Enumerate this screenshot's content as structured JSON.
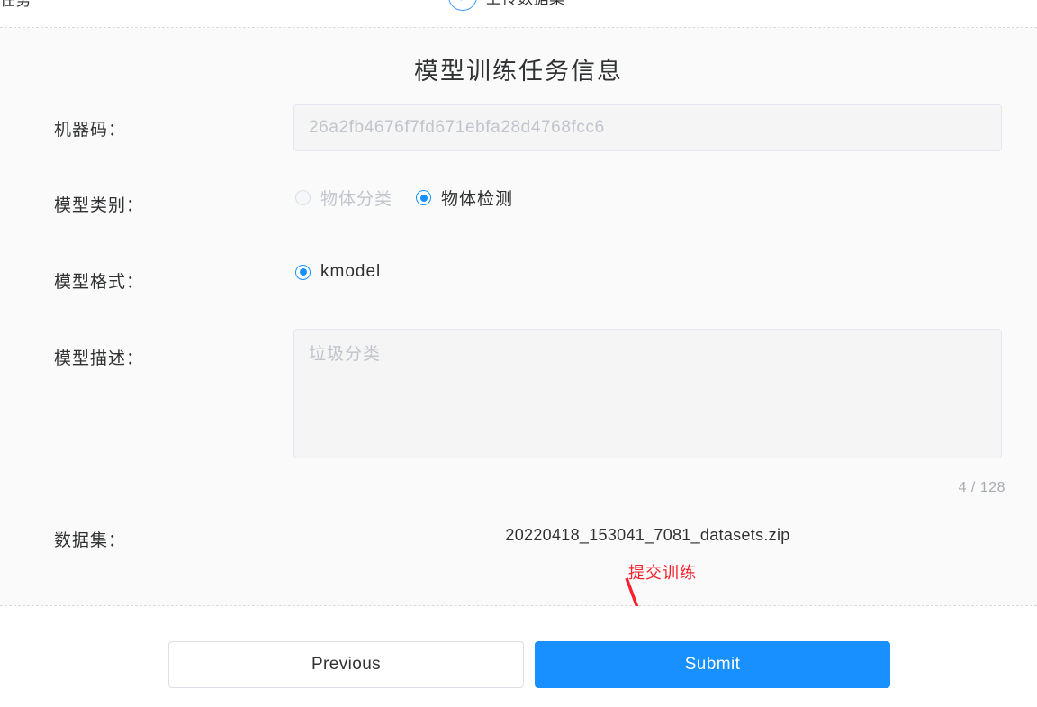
{
  "steps": {
    "left_label": "任务",
    "completed_step_title": "上传数据集",
    "check_icon": "check-icon"
  },
  "form": {
    "title": "模型训练任务信息",
    "machine_code": {
      "label": "机器码：",
      "value": "26a2fb4676f7fd671ebfa28d4768fcc6"
    },
    "model_type": {
      "label": "模型类别：",
      "options": [
        {
          "label": "物体分类",
          "selected": false,
          "disabled": true
        },
        {
          "label": "物体检测",
          "selected": true,
          "disabled": false
        }
      ]
    },
    "model_format": {
      "label": "模型格式：",
      "options": [
        {
          "label": "kmodel",
          "selected": true,
          "disabled": false
        }
      ]
    },
    "model_description": {
      "label": "模型描述：",
      "value": "垃圾分类",
      "placeholder": "垃圾分类",
      "counter": "4 / 128"
    },
    "dataset": {
      "label": "数据集：",
      "value": "20220418_153041_7081_datasets.zip"
    }
  },
  "annotation": {
    "text": "提交训练",
    "color": "#f5222d",
    "arrow": "arrow-icon"
  },
  "footer": {
    "previous_label": "Previous",
    "submit_label": "Submit"
  },
  "colors": {
    "accent": "#1890ff",
    "step_accent": "#409eff",
    "annotation": "#f5222d",
    "form_bg": "#fafafa",
    "field_bg": "#f5f5f5"
  }
}
